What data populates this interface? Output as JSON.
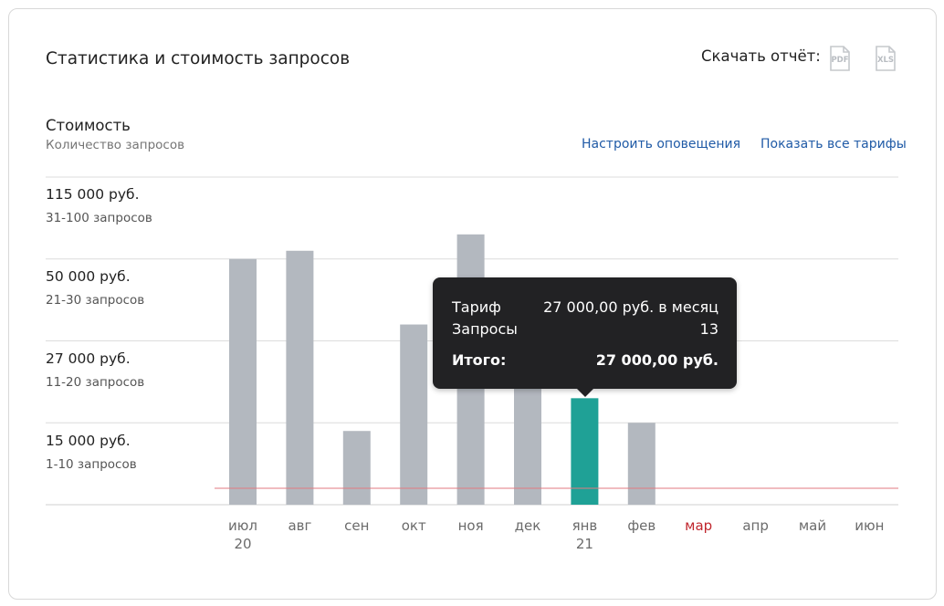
{
  "header": {
    "title": "Статистика и стоимость запросов",
    "download_label": "Скачать отчёт:",
    "pdf_label": "PDF",
    "xls_label": "XLS"
  },
  "legend": {
    "main": "Стоимость",
    "sub": "Количество запросов"
  },
  "links": {
    "alerts": "Настроить оповещения",
    "tariffs": "Показать все тарифы"
  },
  "tiers": [
    {
      "price": "115 000 руб.",
      "count": "31-100 запросов"
    },
    {
      "price": "50 000 руб.",
      "count": "21-30 запросов"
    },
    {
      "price": "27 000 руб.",
      "count": "11-20 запросов"
    },
    {
      "price": "15 000 руб.",
      "count": "1-10 запросов"
    }
  ],
  "tooltip": {
    "tariff_label": "Тариф",
    "tariff_value": "27 000,00 руб. в месяц",
    "requests_label": "Запросы",
    "requests_value": "13",
    "total_label": "Итого:",
    "total_value": "27 000,00 руб."
  },
  "colors": {
    "bar": "#b3b8bf",
    "bar_selected": "#1fa196",
    "future_month": "#c0262d",
    "threshold_line": "#e07a80",
    "grid": "#dcdcdc"
  },
  "chart_data": {
    "type": "bar",
    "categories": [
      "июл",
      "авг",
      "сен",
      "окт",
      "ноя",
      "дек",
      "янв",
      "фев",
      "мар",
      "апр",
      "май",
      "июн"
    ],
    "year_labels": [
      "20",
      "",
      "",
      "",
      "",
      "",
      "21",
      "",
      "",
      "",
      "",
      ""
    ],
    "values": [
      30,
      31,
      9,
      22,
      33,
      15,
      13,
      10,
      null,
      null,
      null,
      null
    ],
    "selected_index": 6,
    "highlight_index": 8,
    "threshold": 2,
    "ylim": [
      0,
      40
    ],
    "tier_bounds": [
      0,
      10,
      20,
      30,
      40
    ],
    "grid": true
  }
}
